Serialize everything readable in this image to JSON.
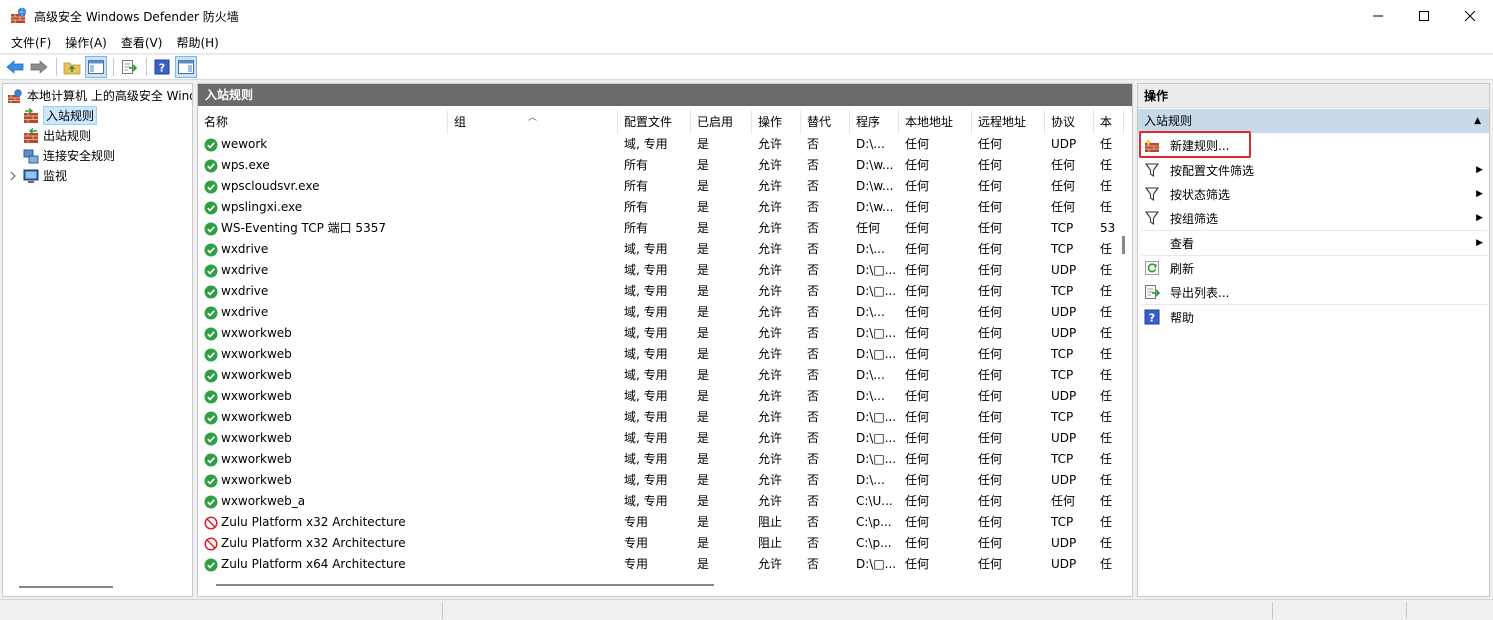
{
  "window": {
    "title": "高级安全 Windows Defender 防火墙",
    "icon": "firewall-app-icon",
    "controls": [
      "minimize-icon",
      "maximize-icon",
      "close-icon"
    ]
  },
  "menu": {
    "items": [
      "文件(F)",
      "操作(A)",
      "查看(V)",
      "帮助(H)"
    ]
  },
  "toolbar": {
    "buttons": [
      "back-arrow-icon",
      "forward-arrow-icon",
      "up-folder-icon",
      "show-hide-tree-icon",
      "export-list-icon",
      "help-icon",
      "show-hide-action-pane-icon"
    ]
  },
  "tree": {
    "root": "本地计算机 上的高级安全 Wind",
    "items": [
      {
        "label": "入站规则",
        "selected": true
      },
      {
        "label": "出站规则",
        "selected": false
      },
      {
        "label": "连接安全规则",
        "selected": false
      },
      {
        "label": "监视",
        "selected": false
      }
    ]
  },
  "center": {
    "header": "入站规则",
    "columns": [
      "名称",
      "组",
      "配置文件",
      "已启用",
      "操作",
      "替代",
      "程序",
      "本地地址",
      "远程地址",
      "协议",
      "本"
    ],
    "rows": [
      {
        "status": "allow",
        "name": "wework",
        "group": "",
        "profile": "域, 专用",
        "enabled": "是",
        "action": "允许",
        "override": "否",
        "program": "D:\\...",
        "local": "任何",
        "remote": "任何",
        "protocol": "UDP",
        "extra": "任"
      },
      {
        "status": "allow",
        "name": "wps.exe",
        "group": "",
        "profile": "所有",
        "enabled": "是",
        "action": "允许",
        "override": "否",
        "program": "D:\\w...",
        "local": "任何",
        "remote": "任何",
        "protocol": "任何",
        "extra": "任"
      },
      {
        "status": "allow",
        "name": "wpscloudsvr.exe",
        "group": "",
        "profile": "所有",
        "enabled": "是",
        "action": "允许",
        "override": "否",
        "program": "D:\\w...",
        "local": "任何",
        "remote": "任何",
        "protocol": "任何",
        "extra": "任"
      },
      {
        "status": "allow",
        "name": "wpslingxi.exe",
        "group": "",
        "profile": "所有",
        "enabled": "是",
        "action": "允许",
        "override": "否",
        "program": "D:\\w...",
        "local": "任何",
        "remote": "任何",
        "protocol": "任何",
        "extra": "任"
      },
      {
        "status": "allow",
        "name": "WS-Eventing TCP 端口 5357",
        "group": "",
        "profile": "所有",
        "enabled": "是",
        "action": "允许",
        "override": "否",
        "program": "任何",
        "local": "任何",
        "remote": "任何",
        "protocol": "TCP",
        "extra": "53"
      },
      {
        "status": "allow",
        "name": "wxdrive",
        "group": "",
        "profile": "域, 专用",
        "enabled": "是",
        "action": "允许",
        "override": "否",
        "program": "D:\\...",
        "local": "任何",
        "remote": "任何",
        "protocol": "TCP",
        "extra": "任"
      },
      {
        "status": "allow",
        "name": "wxdrive",
        "group": "",
        "profile": "域, 专用",
        "enabled": "是",
        "action": "允许",
        "override": "否",
        "program": "D:\\□...",
        "local": "任何",
        "remote": "任何",
        "protocol": "UDP",
        "extra": "任"
      },
      {
        "status": "allow",
        "name": "wxdrive",
        "group": "",
        "profile": "域, 专用",
        "enabled": "是",
        "action": "允许",
        "override": "否",
        "program": "D:\\□...",
        "local": "任何",
        "remote": "任何",
        "protocol": "TCP",
        "extra": "任"
      },
      {
        "status": "allow",
        "name": "wxdrive",
        "group": "",
        "profile": "域, 专用",
        "enabled": "是",
        "action": "允许",
        "override": "否",
        "program": "D:\\...",
        "local": "任何",
        "remote": "任何",
        "protocol": "UDP",
        "extra": "任"
      },
      {
        "status": "allow",
        "name": "wxworkweb",
        "group": "",
        "profile": "域, 专用",
        "enabled": "是",
        "action": "允许",
        "override": "否",
        "program": "D:\\□...",
        "local": "任何",
        "remote": "任何",
        "protocol": "UDP",
        "extra": "任"
      },
      {
        "status": "allow",
        "name": "wxworkweb",
        "group": "",
        "profile": "域, 专用",
        "enabled": "是",
        "action": "允许",
        "override": "否",
        "program": "D:\\□...",
        "local": "任何",
        "remote": "任何",
        "protocol": "TCP",
        "extra": "任"
      },
      {
        "status": "allow",
        "name": "wxworkweb",
        "group": "",
        "profile": "域, 专用",
        "enabled": "是",
        "action": "允许",
        "override": "否",
        "program": "D:\\...",
        "local": "任何",
        "remote": "任何",
        "protocol": "TCP",
        "extra": "任"
      },
      {
        "status": "allow",
        "name": "wxworkweb",
        "group": "",
        "profile": "域, 专用",
        "enabled": "是",
        "action": "允许",
        "override": "否",
        "program": "D:\\...",
        "local": "任何",
        "remote": "任何",
        "protocol": "UDP",
        "extra": "任"
      },
      {
        "status": "allow",
        "name": "wxworkweb",
        "group": "",
        "profile": "域, 专用",
        "enabled": "是",
        "action": "允许",
        "override": "否",
        "program": "D:\\□...",
        "local": "任何",
        "remote": "任何",
        "protocol": "TCP",
        "extra": "任"
      },
      {
        "status": "allow",
        "name": "wxworkweb",
        "group": "",
        "profile": "域, 专用",
        "enabled": "是",
        "action": "允许",
        "override": "否",
        "program": "D:\\□...",
        "local": "任何",
        "remote": "任何",
        "protocol": "UDP",
        "extra": "任"
      },
      {
        "status": "allow",
        "name": "wxworkweb",
        "group": "",
        "profile": "域, 专用",
        "enabled": "是",
        "action": "允许",
        "override": "否",
        "program": "D:\\□...",
        "local": "任何",
        "remote": "任何",
        "protocol": "TCP",
        "extra": "任"
      },
      {
        "status": "allow",
        "name": "wxworkweb",
        "group": "",
        "profile": "域, 专用",
        "enabled": "是",
        "action": "允许",
        "override": "否",
        "program": "D:\\...",
        "local": "任何",
        "remote": "任何",
        "protocol": "UDP",
        "extra": "任"
      },
      {
        "status": "allow",
        "name": "wxworkweb_a",
        "group": "",
        "profile": "域, 专用",
        "enabled": "是",
        "action": "允许",
        "override": "否",
        "program": "C:\\U...",
        "local": "任何",
        "remote": "任何",
        "protocol": "任何",
        "extra": "任"
      },
      {
        "status": "block",
        "name": "Zulu Platform x32 Architecture",
        "group": "",
        "profile": "专用",
        "enabled": "是",
        "action": "阻止",
        "override": "否",
        "program": "C:\\p...",
        "local": "任何",
        "remote": "任何",
        "protocol": "TCP",
        "extra": "任"
      },
      {
        "status": "block",
        "name": "Zulu Platform x32 Architecture",
        "group": "",
        "profile": "专用",
        "enabled": "是",
        "action": "阻止",
        "override": "否",
        "program": "C:\\p...",
        "local": "任何",
        "remote": "任何",
        "protocol": "UDP",
        "extra": "任"
      },
      {
        "status": "allow",
        "name": "Zulu Platform x64 Architecture",
        "group": "",
        "profile": "专用",
        "enabled": "是",
        "action": "允许",
        "override": "否",
        "program": "D:\\□...",
        "local": "任何",
        "remote": "任何",
        "protocol": "UDP",
        "extra": "任"
      }
    ]
  },
  "actions": {
    "header": "操作",
    "section": "入站规则",
    "items": [
      {
        "label": "新建规则...",
        "icon": "new-rule-icon",
        "arrow": false,
        "highlighted": true
      },
      {
        "label": "按配置文件筛选",
        "icon": "filter-icon",
        "arrow": true
      },
      {
        "label": "按状态筛选",
        "icon": "filter-icon",
        "arrow": true
      },
      {
        "label": "按组筛选",
        "icon": "filter-icon",
        "arrow": true
      },
      {
        "label": "查看",
        "icon": "",
        "arrow": true
      },
      {
        "label": "刷新",
        "icon": "refresh-icon",
        "arrow": false
      },
      {
        "label": "导出列表...",
        "icon": "export-list-icon",
        "arrow": false
      },
      {
        "label": "帮助",
        "icon": "help-icon",
        "arrow": false
      }
    ]
  },
  "colors": {
    "allow": "#2ea043",
    "block": "#d9202a",
    "section_bg": "#c8d9ea",
    "header_bg": "#6b6b6b",
    "highlight": "#e0282f"
  }
}
